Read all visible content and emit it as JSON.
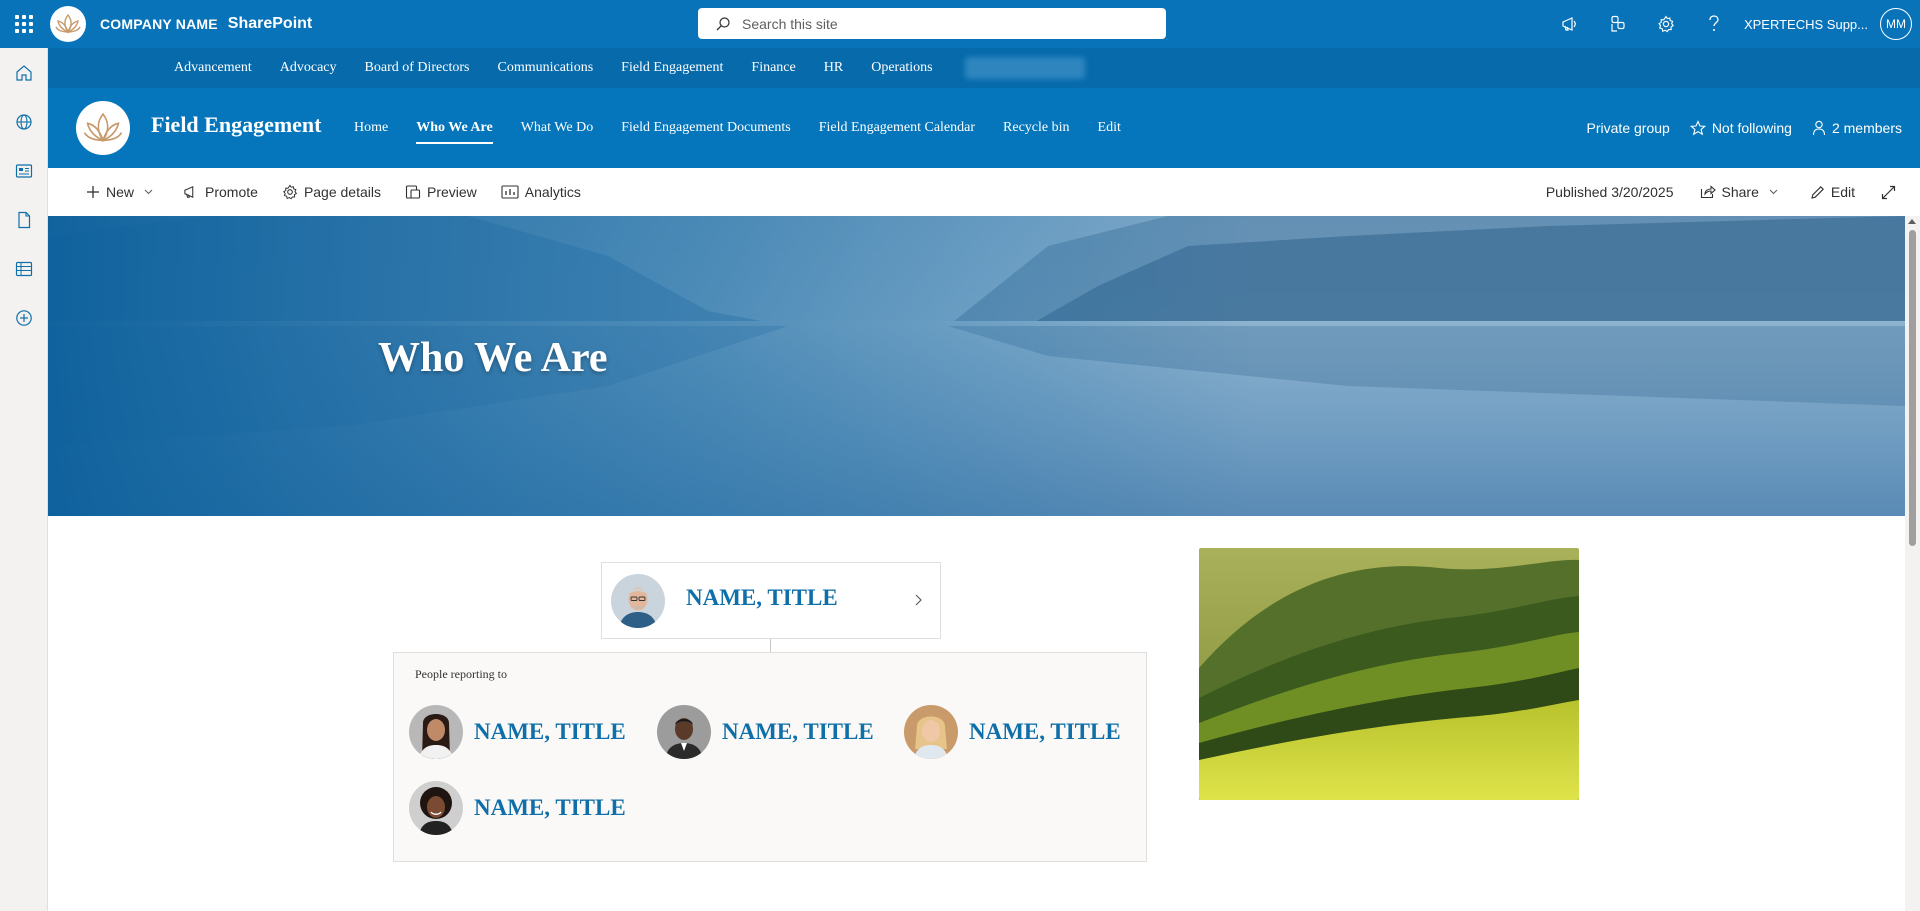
{
  "suite_bar": {
    "company_name": "COMPANY NAME",
    "app_name": "SharePoint",
    "search_placeholder": "Search this site",
    "user_name": "XPERTECHS Supp...",
    "user_initials": "MM",
    "icons": [
      "megaphone-icon",
      "collaboration-icon",
      "settings-icon",
      "help-icon"
    ]
  },
  "app_rail": {
    "icons": [
      "home-icon",
      "globe-icon",
      "news-icon",
      "document-icon",
      "list-icon",
      "add-icon"
    ]
  },
  "hub_nav": {
    "items": [
      "Advancement",
      "Advocacy",
      "Board of Directors",
      "Communications",
      "Field Engagement",
      "Finance",
      "HR",
      "Operations"
    ]
  },
  "site_header": {
    "title": "Field Engagement",
    "nav": [
      "Home",
      "Who We Are",
      "What We Do",
      "Field Engagement Documents",
      "Field Engagement Calendar",
      "Recycle bin",
      "Edit"
    ],
    "active_nav": "Who We Are",
    "privacy": "Private group",
    "follow": "Not following",
    "members": "2 members"
  },
  "command_bar": {
    "new": "New",
    "promote": "Promote",
    "page_details": "Page details",
    "preview": "Preview",
    "analytics": "Analytics",
    "published": "Published 3/20/2025",
    "share": "Share",
    "edit": "Edit"
  },
  "hero": {
    "title": "Who We Are"
  },
  "org_chart": {
    "manager": {
      "name": "NAME, TITLE"
    },
    "reports_label": "People reporting to",
    "reports": [
      {
        "name": "NAME, TITLE"
      },
      {
        "name": "NAME, TITLE"
      },
      {
        "name": "NAME, TITLE"
      },
      {
        "name": "NAME, TITLE"
      }
    ]
  },
  "colors": {
    "suite_bar": "#0873b9",
    "hub_nav": "#076aab",
    "site_header": "#0576bb",
    "name_link": "#0f6fa8"
  }
}
